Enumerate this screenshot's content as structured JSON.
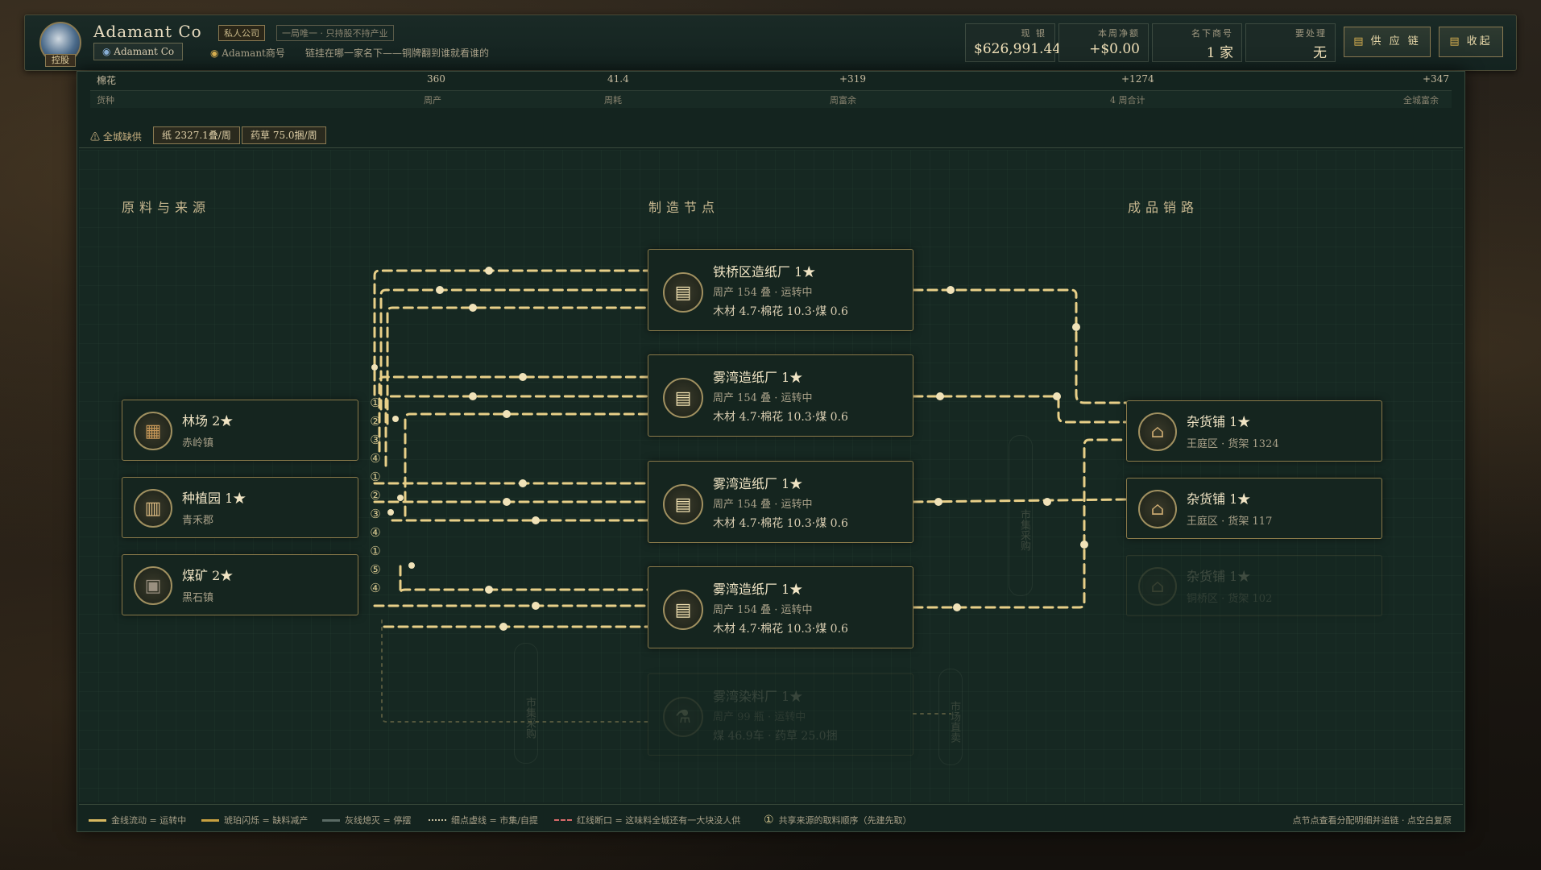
{
  "company": {
    "tag": "控股",
    "name": "Adamant Co",
    "badge_type": "私人公司",
    "badge_desc": "一局唯一 · 只持股不持产业",
    "chip": "Adamant Co",
    "brand": "Adamant商号",
    "slogan": "链挂在哪一家名下——铜牌翻到谁就看谁的"
  },
  "stats": [
    {
      "label": "现 银",
      "value": "$626,991.44"
    },
    {
      "label": "本周净额",
      "value": "+$0.00"
    },
    {
      "label": "名下商号",
      "value": "1 家"
    },
    {
      "label": "要处理",
      "value": "无"
    }
  ],
  "buttons": {
    "supply": "供 应 链",
    "collapse": "收起"
  },
  "table": {
    "row": [
      "棉花",
      "360",
      "41.4",
      "+319",
      "+1274",
      "+347"
    ],
    "headers": [
      "货种",
      "周产",
      "周耗",
      "周富余",
      "4 周合计",
      "全城富余"
    ]
  },
  "shortage": {
    "label": "全城缺供",
    "items": [
      "纸 2327.1叠/周",
      "药草 75.0捆/周"
    ]
  },
  "columns": [
    "原料与来源",
    "制造节点",
    "成品销路"
  ],
  "sources": [
    {
      "title": "林场 2★",
      "sub": "赤岭镇",
      "icon": "lumber-icon"
    },
    {
      "title": "种植园 1★",
      "sub": "青禾郡",
      "icon": "cotton-bale-icon"
    },
    {
      "title": "煤矿 2★",
      "sub": "黑石镇",
      "icon": "coal-cart-icon"
    }
  ],
  "factories": [
    {
      "title": "铁桥区造纸厂 1★",
      "s1": "周产 154 叠 · 运转中",
      "s2": "木材 4.7·棉花 10.3·煤 0.6"
    },
    {
      "title": "雾湾造纸厂 1★",
      "s1": "周产 154 叠 · 运转中",
      "s2": "木材 4.7·棉花 10.3·煤 0.6"
    },
    {
      "title": "雾湾造纸厂 1★",
      "s1": "周产 154 叠 · 运转中",
      "s2": "木材 4.7·棉花 10.3·煤 0.6"
    },
    {
      "title": "雾湾造纸厂 1★",
      "s1": "周产 154 叠 · 运转中",
      "s2": "木材 4.7·棉花 10.3·煤 0.6"
    },
    {
      "title": "雾湾染料厂 1★",
      "s1": "周产 99 瓶 · 运转中",
      "s2": "煤 46.9车 · 药草 25.0捆"
    }
  ],
  "shops": [
    {
      "title": "杂货铺 1★",
      "sub": "王庭区 · 货架 1324"
    },
    {
      "title": "杂货铺 1★",
      "sub": "王庭区 · 货架 117"
    },
    {
      "title": "杂货铺 1★",
      "sub": "铜桥区 · 货架 102"
    }
  ],
  "market_tags": [
    "市集采购",
    "市集采购",
    "市场直卖"
  ],
  "order_marks": [
    "①",
    "②",
    "③",
    "④",
    "①",
    "②",
    "③",
    "④",
    "①",
    "⑤",
    "④"
  ],
  "legend": [
    "金线流动 = 运转中",
    "琥珀闪烁 = 缺料减产",
    "灰线熄灭 = 停摆",
    "细点虚线 = 市集/自提",
    "红线断口 = 这味料全城还有一大块没人供",
    "共享来源的取料顺序（先建先取）"
  ],
  "legend_mark": "①",
  "hint": "点节点查看分配明细并追链 · 点空白复原",
  "colors": {
    "gold": "#e8cf88",
    "amber": "#d8b050",
    "gray": "#6a7a70",
    "red": "#d86a6a",
    "panel": "#15251f"
  }
}
